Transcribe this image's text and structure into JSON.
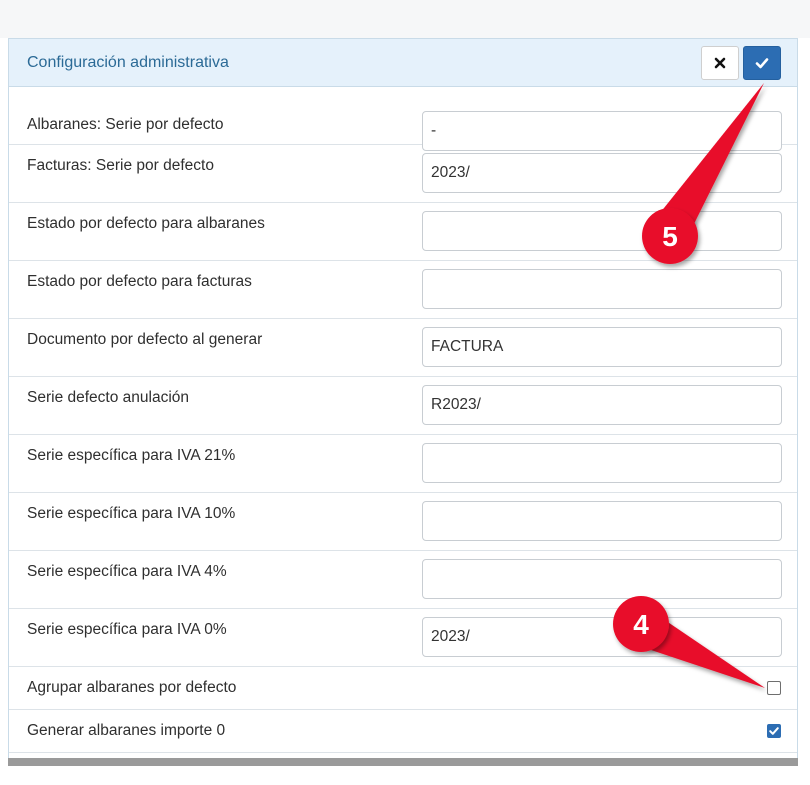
{
  "panel": {
    "title": "Configuración administrativa"
  },
  "header_buttons": {
    "close_icon": "close-icon",
    "confirm_icon": "check-icon"
  },
  "fields": [
    {
      "label": "Albaranes: Serie por defecto",
      "value": "-"
    },
    {
      "label": "Facturas: Serie por defecto",
      "value": "2023/"
    },
    {
      "label": "Estado por defecto para albaranes",
      "value": ""
    },
    {
      "label": "Estado por defecto para facturas",
      "value": ""
    },
    {
      "label": "Documento por defecto al generar",
      "value": "FACTURA"
    },
    {
      "label": "Serie defecto anulación",
      "value": "R2023/"
    },
    {
      "label": "Serie específica para IVA 21%",
      "value": ""
    },
    {
      "label": "Serie específica para IVA 10%",
      "value": ""
    },
    {
      "label": "Serie específica para IVA 4%",
      "value": ""
    },
    {
      "label": "Serie específica para IVA 0%",
      "value": "2023/"
    }
  ],
  "checkboxes": [
    {
      "label": "Agrupar albaranes por defecto",
      "checked": false
    },
    {
      "label": "Generar albaranes importe 0",
      "checked": true
    }
  ],
  "annotations": {
    "badge_5": "5",
    "badge_4": "4",
    "color": "#e8102a"
  },
  "colors": {
    "accent": "#2c6db3",
    "header_bg": "#e5f1fb",
    "title_color": "#2b6a96"
  }
}
